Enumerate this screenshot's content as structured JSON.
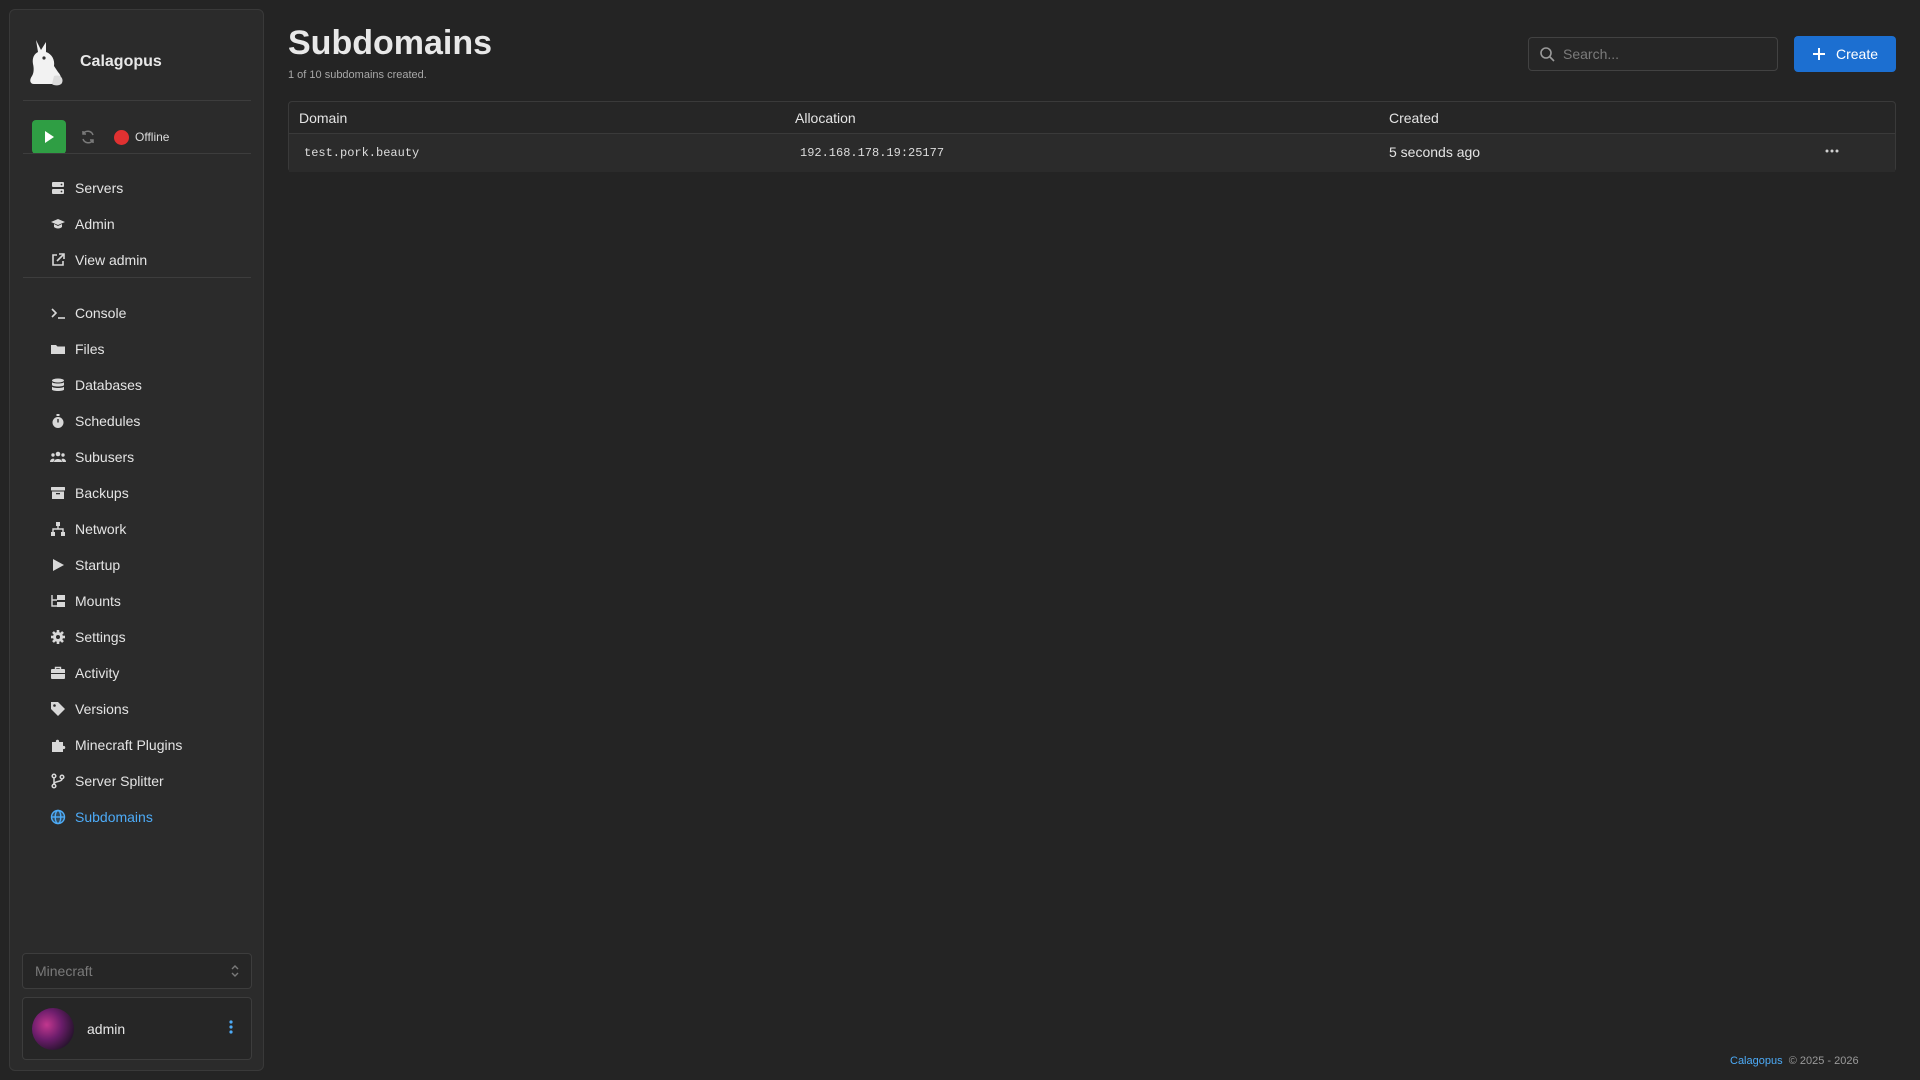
{
  "app": {
    "name": "Calagopus"
  },
  "server_status": {
    "label": "Offline",
    "color": "#e03131"
  },
  "nav_top": [
    {
      "label": "Servers",
      "icon": "server-icon"
    },
    {
      "label": "Admin",
      "icon": "graduation-cap-icon"
    },
    {
      "label": "View admin",
      "icon": "external-link-icon"
    }
  ],
  "nav_server": [
    {
      "label": "Console",
      "icon": "terminal-icon"
    },
    {
      "label": "Files",
      "icon": "folder-icon"
    },
    {
      "label": "Databases",
      "icon": "database-icon"
    },
    {
      "label": "Schedules",
      "icon": "stopwatch-icon"
    },
    {
      "label": "Subusers",
      "icon": "users-icon"
    },
    {
      "label": "Backups",
      "icon": "archive-box-icon"
    },
    {
      "label": "Network",
      "icon": "network-icon"
    },
    {
      "label": "Startup",
      "icon": "play-icon"
    },
    {
      "label": "Mounts",
      "icon": "folder-tree-icon"
    },
    {
      "label": "Settings",
      "icon": "gear-icon"
    },
    {
      "label": "Activity",
      "icon": "briefcase-icon"
    },
    {
      "label": "Versions",
      "icon": "tag-icon"
    },
    {
      "label": "Minecraft Plugins",
      "icon": "puzzle-icon"
    },
    {
      "label": "Server Splitter",
      "icon": "code-branch-icon"
    },
    {
      "label": "Subdomains",
      "icon": "globe-icon",
      "active": true
    }
  ],
  "egg_select": {
    "value": "Minecraft"
  },
  "user": {
    "name": "admin"
  },
  "page": {
    "title": "Subdomains",
    "subtitle": "1 of 10 subdomains created."
  },
  "search": {
    "placeholder": "Search..."
  },
  "create_button": {
    "label": "Create"
  },
  "table": {
    "columns": [
      "Domain",
      "Allocation",
      "Created"
    ],
    "rows": [
      {
        "domain": "test.pork.beauty",
        "allocation": "192.168.178.19:25177",
        "created": "5 seconds ago"
      }
    ]
  },
  "footer": {
    "brand": "Calagopus",
    "copyright": "© 2025 - 2026"
  },
  "colors": {
    "accent": "#1c6fd1",
    "active_link": "#4dabf7",
    "start_button": "#2f9e44"
  }
}
